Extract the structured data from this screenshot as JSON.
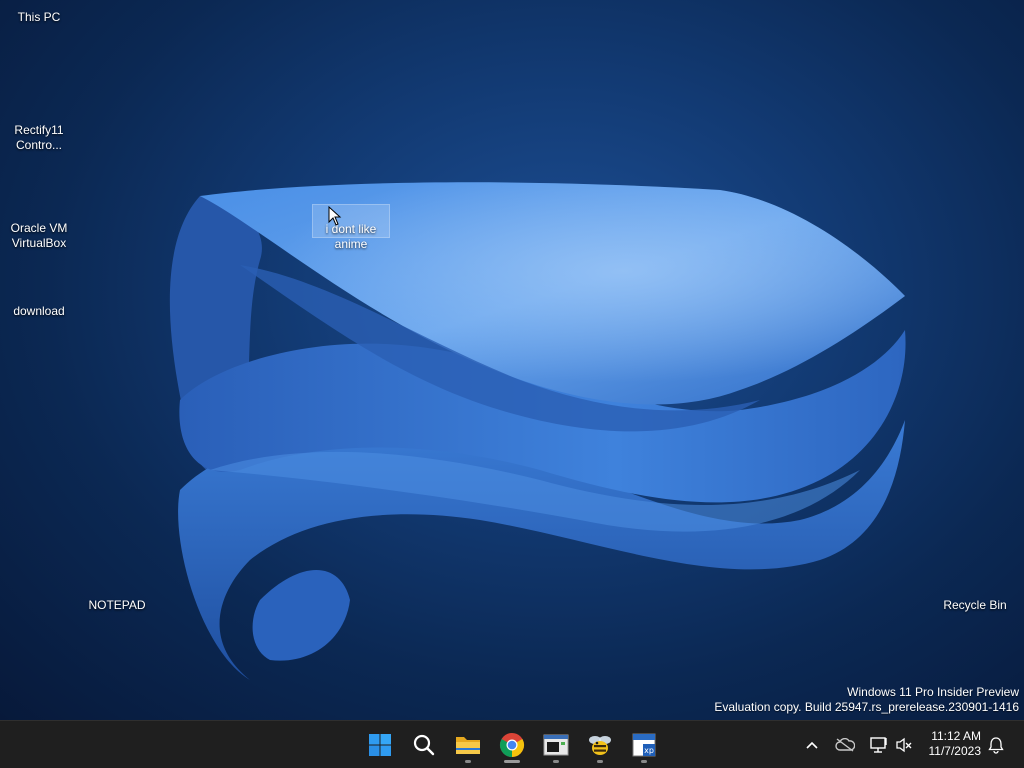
{
  "desktop_icons": [
    {
      "id": "this-pc",
      "label": "This PC"
    },
    {
      "id": "rectify11",
      "label": "Rectify11\nContro..."
    },
    {
      "id": "virtualbox",
      "label": "Oracle VM\nVirtualBox"
    },
    {
      "id": "download",
      "label": "download"
    },
    {
      "id": "notepad",
      "label": "NOTEPAD"
    },
    {
      "id": "recycle-bin",
      "label": "Recycle Bin"
    }
  ],
  "selected_file": {
    "label": "i dont like\nanime"
  },
  "watermark": {
    "line1": "Windows 11 Pro Insider Preview",
    "line2": "Evaluation copy. Build 25947.rs_prerelease.230901-1416"
  },
  "taskbar": {
    "apps": [
      {
        "name": "start",
        "icon": "windows-logo-icon"
      },
      {
        "name": "search",
        "icon": "search-icon"
      },
      {
        "name": "file-explorer",
        "icon": "folder-icon",
        "running": true
      },
      {
        "name": "chrome",
        "icon": "chrome-icon",
        "running": true,
        "active": true
      },
      {
        "name": "console-app",
        "icon": "terminal-window-icon",
        "running": true
      },
      {
        "name": "bee-app",
        "icon": "bee-icon",
        "running": true
      },
      {
        "name": "winxp-tool",
        "icon": "xp-tool-icon",
        "running": true
      }
    ],
    "tray": {
      "chevron": "chevron-up-icon",
      "onedrive": "cloud-offline-icon",
      "network": "network-icon",
      "volume": "volume-muted-icon",
      "notifications": "bell-icon"
    },
    "clock": {
      "time": "11:12 AM",
      "date": "11/7/2023"
    }
  },
  "colors": {
    "taskbar_bg": "#1f1f1f",
    "wallpaper_bloom": "#3a7ad6",
    "start_blue": "#2f9bf0"
  }
}
